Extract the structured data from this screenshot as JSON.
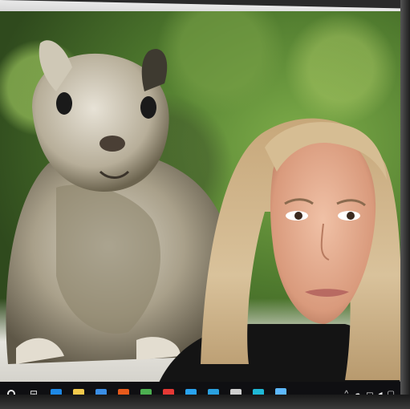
{
  "scene": {
    "photo_subjects": [
      "squirrel",
      "person"
    ]
  },
  "taskbar": {
    "start_icon": "windows-start-icon",
    "task_view_icon": "task-view-icon",
    "apps": [
      {
        "name": "edge-icon",
        "color": "#1e88e5"
      },
      {
        "name": "file-explorer-icon",
        "color": "#f2c94c"
      },
      {
        "name": "mail-icon",
        "color": "#3a8ee6"
      },
      {
        "name": "office-icon",
        "color": "#e85a1b"
      },
      {
        "name": "chrome-icon",
        "color": "#4caf50"
      },
      {
        "name": "app-red-icon",
        "color": "#e53935"
      },
      {
        "name": "store-icon",
        "color": "#29a3f0"
      },
      {
        "name": "remote-desktop-icon",
        "color": "#2aa1e0"
      },
      {
        "name": "calculator-icon",
        "color": "#cfcfcf"
      },
      {
        "name": "photos-icon",
        "color": "#1fb8d6"
      },
      {
        "name": "active-app-icon",
        "color": "#5db8ff"
      }
    ],
    "tray": {
      "chevron": "^",
      "icons": [
        "cloud-icon",
        "network-icon",
        "volume-icon",
        "chat-icon"
      ]
    }
  }
}
